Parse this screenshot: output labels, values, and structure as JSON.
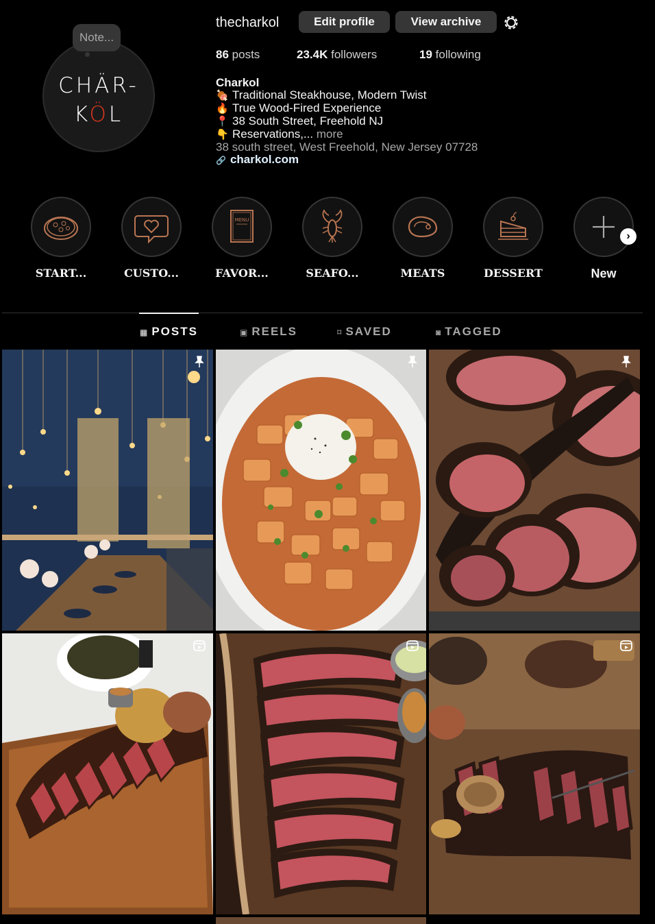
{
  "profile": {
    "note": "Note...",
    "logo_line1": "CHÄR-",
    "logo_line2_a": "K",
    "logo_line2_flame": "Ö",
    "logo_line2_b": "L",
    "username": "thecharkol",
    "edit_label": "Edit profile",
    "archive_label": "View archive"
  },
  "stats": {
    "posts_count": "86",
    "posts_label": "posts",
    "followers_count": "23.4K",
    "followers_label": "followers",
    "following_count": "19",
    "following_label": "following"
  },
  "bio": {
    "name": "Charkol",
    "line1": "Traditional Steakhouse, Modern Twist",
    "line2": "True Wood-Fired Experience",
    "line3": "38 South Street, Freehold NJ",
    "line4": "Reservations,...",
    "more": "more",
    "address": "38 south street, West Freehold, New Jersey 07728",
    "link": "charkol.com"
  },
  "highlights": [
    {
      "label": "START...",
      "icon": "pizza-icon"
    },
    {
      "label": "CUSTO...",
      "icon": "heart-chat-icon"
    },
    {
      "label": "FAVOR...",
      "icon": "menu-icon"
    },
    {
      "label": "SEAFO...",
      "icon": "lobster-icon"
    },
    {
      "label": "MEATS",
      "icon": "steak-icon"
    },
    {
      "label": "DESSERT",
      "icon": "cake-icon"
    },
    {
      "label": "New",
      "icon": "plus-icon"
    }
  ],
  "tabs": [
    {
      "label": "POSTS",
      "icon": "grid-icon",
      "active": true
    },
    {
      "label": "REELS",
      "icon": "reels-icon",
      "active": false
    },
    {
      "label": "SAVED",
      "icon": "bookmark-icon",
      "active": false
    },
    {
      "label": "TAGGED",
      "icon": "tagged-icon",
      "active": false
    }
  ],
  "posts": [
    {
      "badge": "pin-icon",
      "subject": "dining room"
    },
    {
      "badge": "pin-icon",
      "subject": "rigatoni with burrata"
    },
    {
      "badge": "pin-icon",
      "subject": "sliced steak"
    },
    {
      "badge": "reel-icon",
      "subject": "tomahawk platter"
    },
    {
      "badge": "reel-icon",
      "subject": "tomahawk slices"
    },
    {
      "badge": "reel-icon",
      "subject": "steak on board"
    }
  ],
  "colors": {
    "background": "#000000",
    "button": "#363636",
    "accent_flame": "#e0381f",
    "muted": "#a8a8a8"
  }
}
